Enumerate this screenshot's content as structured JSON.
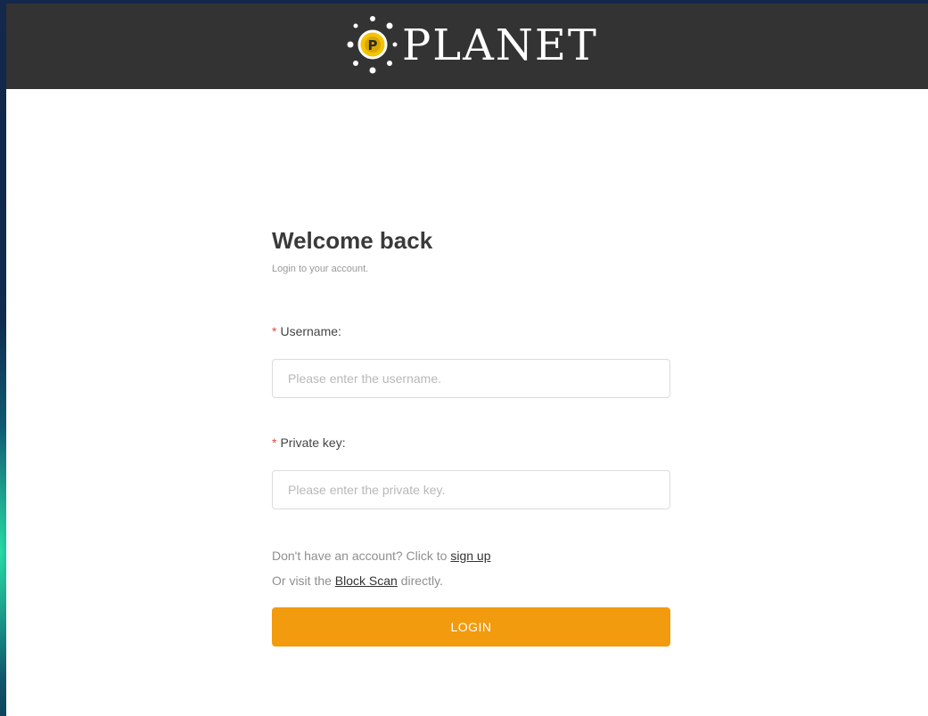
{
  "header": {
    "logo_text": "PLANET",
    "logo_initial": "P"
  },
  "login": {
    "title": "Welcome back",
    "subtitle": "Login to your account.",
    "username": {
      "required_mark": "*",
      "label": "Username:",
      "placeholder": "Please enter the username.",
      "value": ""
    },
    "private_key": {
      "required_mark": "*",
      "label": "Private key:",
      "placeholder": "Please enter the private key.",
      "value": ""
    },
    "signup_prompt": "Don't have an account? Click to ",
    "signup_link": "sign up",
    "visit_prefix": "Or visit the ",
    "block_scan_link": "Block Scan",
    "visit_suffix": " directly.",
    "login_button": "LOGIN"
  },
  "colors": {
    "header_bg": "#333333",
    "accent": "#f29b0f",
    "logo_sun": "#f5c400",
    "required": "#e8453c"
  }
}
